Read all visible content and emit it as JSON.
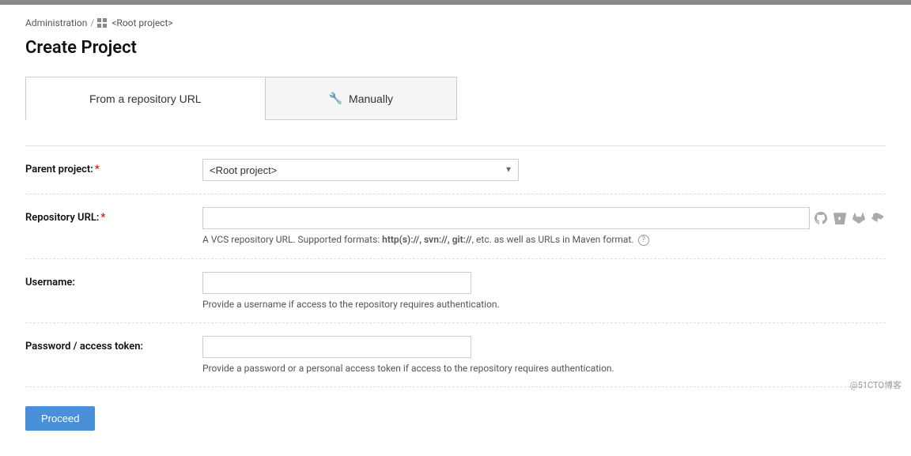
{
  "topbar": {},
  "breadcrumb": {
    "admin_label": "Administration",
    "sep": "/",
    "root_project_label": "<Root project>"
  },
  "page": {
    "title": "Create Project"
  },
  "tabs": [
    {
      "id": "from-url",
      "label": "From a repository URL",
      "active": true,
      "icon": ""
    },
    {
      "id": "manually",
      "label": "Manually",
      "active": false,
      "icon": "🔧"
    }
  ],
  "form": {
    "parent_project": {
      "label": "Parent project:",
      "required": true,
      "value": "<Root project>",
      "options": [
        "<Root project>"
      ]
    },
    "repository_url": {
      "label": "Repository URL:",
      "required": true,
      "value": "",
      "placeholder": "",
      "hint": "A VCS repository URL. Supported formats: ",
      "hint_formats": "http(s)://, svn://, git://",
      "hint_suffix": ", etc. as well as URLs in Maven format."
    },
    "username": {
      "label": "Username:",
      "required": false,
      "value": "",
      "placeholder": "",
      "hint": "Provide a username if access to the repository requires authentication."
    },
    "password": {
      "label": "Password / access token:",
      "required": false,
      "value": "",
      "placeholder": "",
      "hint": "Provide a password or a personal access token if access to the repository requires authentication."
    }
  },
  "actions": {
    "proceed_label": "Proceed"
  },
  "watermark": "@51CTO博客"
}
